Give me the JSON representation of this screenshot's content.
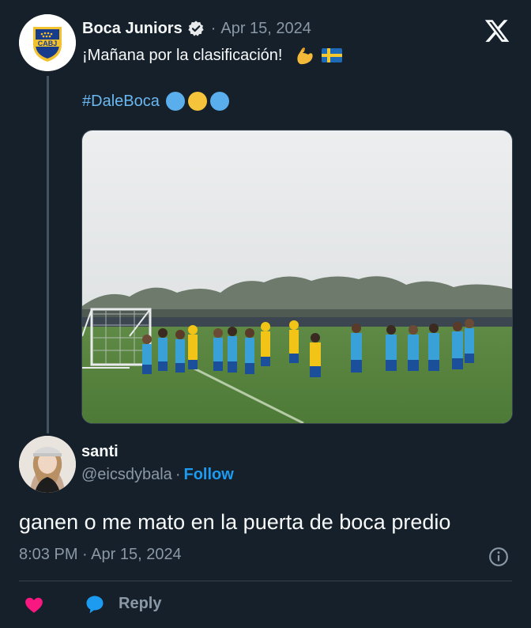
{
  "parent": {
    "author_name": "Boca Juniors",
    "logo_text": "CABJ",
    "separator": "·",
    "date": "Apr 15, 2024",
    "text": "¡Mañana por la clasificación!",
    "emoji": [
      "flexed-biceps",
      "flag-sweden"
    ],
    "hashtag": "#DaleBoca",
    "heart_colors": [
      "#5aaeec",
      "#f5c43b",
      "#5aaeec"
    ]
  },
  "brand": {
    "logo_icon": "x-logo-icon"
  },
  "reply": {
    "author_name": "santi",
    "handle": "@eicsdybala",
    "separator": "·",
    "follow_label": "Follow",
    "text": "ganen o me mato en la puerta de boca predio",
    "timestamp": "8:03 PM · Apr 15, 2024"
  },
  "actions": {
    "reply_label": "Reply",
    "like_icon": "heart-icon",
    "reply_icon": "speech-bubble-icon",
    "info_icon": "info-icon"
  },
  "colors": {
    "background": "#15202b",
    "link": "#1d9bf0",
    "hashtag": "#6bb8f0",
    "like": "#f91880",
    "secondary_text": "#8b98a5"
  }
}
